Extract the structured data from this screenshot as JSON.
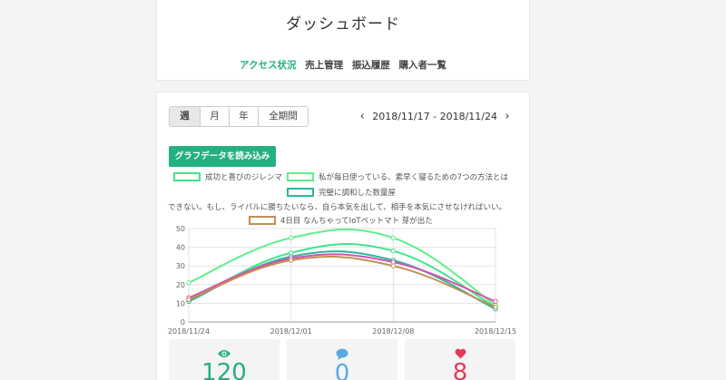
{
  "header": {
    "title": "ダッシュボード",
    "tabs": [
      {
        "label": "アクセス状況",
        "active": true
      },
      {
        "label": "売上管理",
        "active": false
      },
      {
        "label": "振込履歴",
        "active": false
      },
      {
        "label": "購入者一覧",
        "active": false
      }
    ]
  },
  "period": {
    "options": [
      "週",
      "月",
      "年",
      "全期間"
    ],
    "selected": "週"
  },
  "date_range": {
    "label": "2018/11/17 - 2018/11/24",
    "prev_icon": "chevron-left-icon",
    "next_icon": "chevron-right-icon"
  },
  "load_button": {
    "label": "グラフデータを読み込み"
  },
  "chart_data": {
    "type": "line",
    "x": [
      "2018/11/24",
      "2018/12/01",
      "2018/12/08",
      "2018/12/15"
    ],
    "ylim": [
      0,
      50
    ],
    "yticks": [
      0,
      10,
      20,
      30,
      40,
      50
    ],
    "grid": true,
    "legend_position": "top",
    "series": [
      {
        "name": "成功と喜びのジレンマ",
        "color": "#44e38d",
        "values": [
          11,
          37,
          38,
          8
        ]
      },
      {
        "name": "私が毎日使っている、素早く寝るための7つの方法とは",
        "color": "#5ef08a",
        "values": [
          21,
          45,
          45,
          9
        ]
      },
      {
        "name": "完璧に調和した数量屋",
        "color": "#2bb89b",
        "values": [
          11,
          35,
          33,
          7
        ]
      },
      {
        "name": "できない。もし、ライバルに勝ちたいなら、自ら本気を出して、相手を本気にさせなければいい。",
        "color": "#d84fae",
        "values": [
          13,
          34,
          32,
          11
        ]
      },
      {
        "name": "4日目 なんちゃってIoTペットマト 芽が出た",
        "color": "#c09055",
        "values": [
          12,
          33,
          30,
          8
        ]
      }
    ]
  },
  "stats": [
    {
      "icon": "eye-icon",
      "value": "120",
      "color": "#25b07f"
    },
    {
      "icon": "comment-icon",
      "value": "0",
      "color": "#5aa9e0"
    },
    {
      "icon": "heart-icon",
      "value": "8",
      "color": "#e63a5a"
    }
  ]
}
